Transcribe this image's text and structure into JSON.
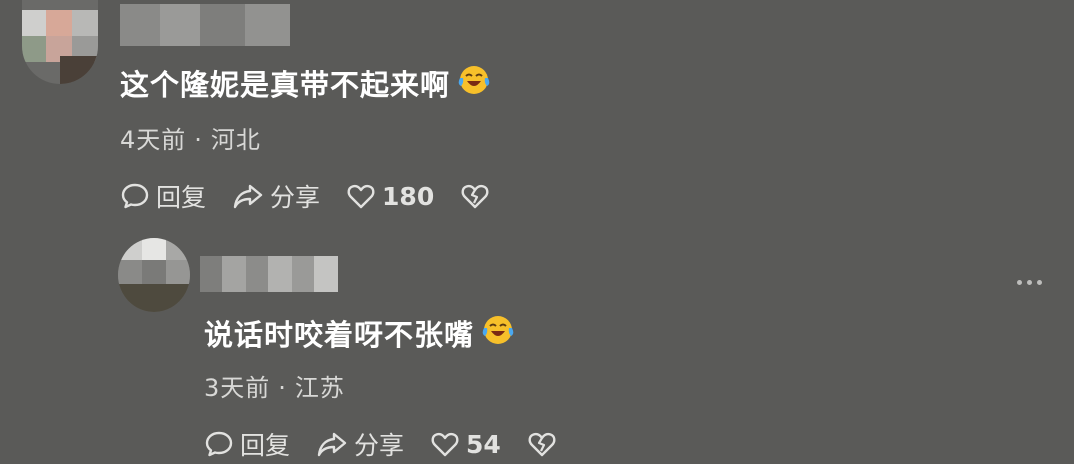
{
  "comments": [
    {
      "text": "这个隆妮是真带不起来啊",
      "emoji": "laughing-crying-emoji",
      "time": "4天前",
      "location": "河北",
      "reply_label": "回复",
      "share_label": "分享",
      "likes": "180"
    },
    {
      "text": "说话时咬着呀不张嘴",
      "emoji": "laughing-crying-emoji",
      "time": "3天前",
      "location": "江苏",
      "reply_label": "回复",
      "share_label": "分享",
      "likes": "54"
    }
  ],
  "separator": "·",
  "colors": {
    "background": "#5a5a58",
    "text": "#ffffff",
    "meta": "#d8d8d6",
    "emoji_face": "#f7c02a",
    "emoji_tear": "#4aa8f0"
  },
  "icons": [
    "comment-bubble-icon",
    "share-arrow-icon",
    "heart-icon",
    "broken-heart-icon",
    "more-dots-icon"
  ]
}
